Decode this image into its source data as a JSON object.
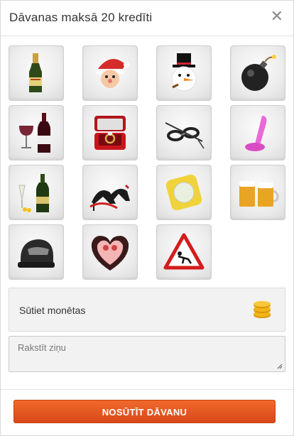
{
  "dialog": {
    "title": "Dāvanas maksā 20 kredīti",
    "close_icon": "close-icon"
  },
  "gifts": [
    {
      "icon": "champagne-bottle-icon"
    },
    {
      "icon": "santa-claus-icon"
    },
    {
      "icon": "snowman-top-hat-icon"
    },
    {
      "icon": "bomb-icon"
    },
    {
      "icon": "wine-bottle-glass-icon"
    },
    {
      "icon": "ring-box-icon"
    },
    {
      "icon": "handcuffs-whip-icon"
    },
    {
      "icon": "pink-toy-icon"
    },
    {
      "icon": "champagne-flutes-icon"
    },
    {
      "icon": "high-heels-icon"
    },
    {
      "icon": "condom-icon"
    },
    {
      "icon": "beer-mugs-icon"
    },
    {
      "icon": "motorcycle-helmet-icon"
    },
    {
      "icon": "heart-couple-icon"
    },
    {
      "icon": "warning-sign-icon"
    }
  ],
  "coins": {
    "label": "Sūtiet monētas",
    "icon": "gold-coins-icon"
  },
  "message": {
    "placeholder": "Rakstīt ziņu"
  },
  "send": {
    "label": "NOSŪTĪT DĀVANU"
  },
  "colors": {
    "accent": "#e85a22",
    "coin": "#f2b417"
  }
}
